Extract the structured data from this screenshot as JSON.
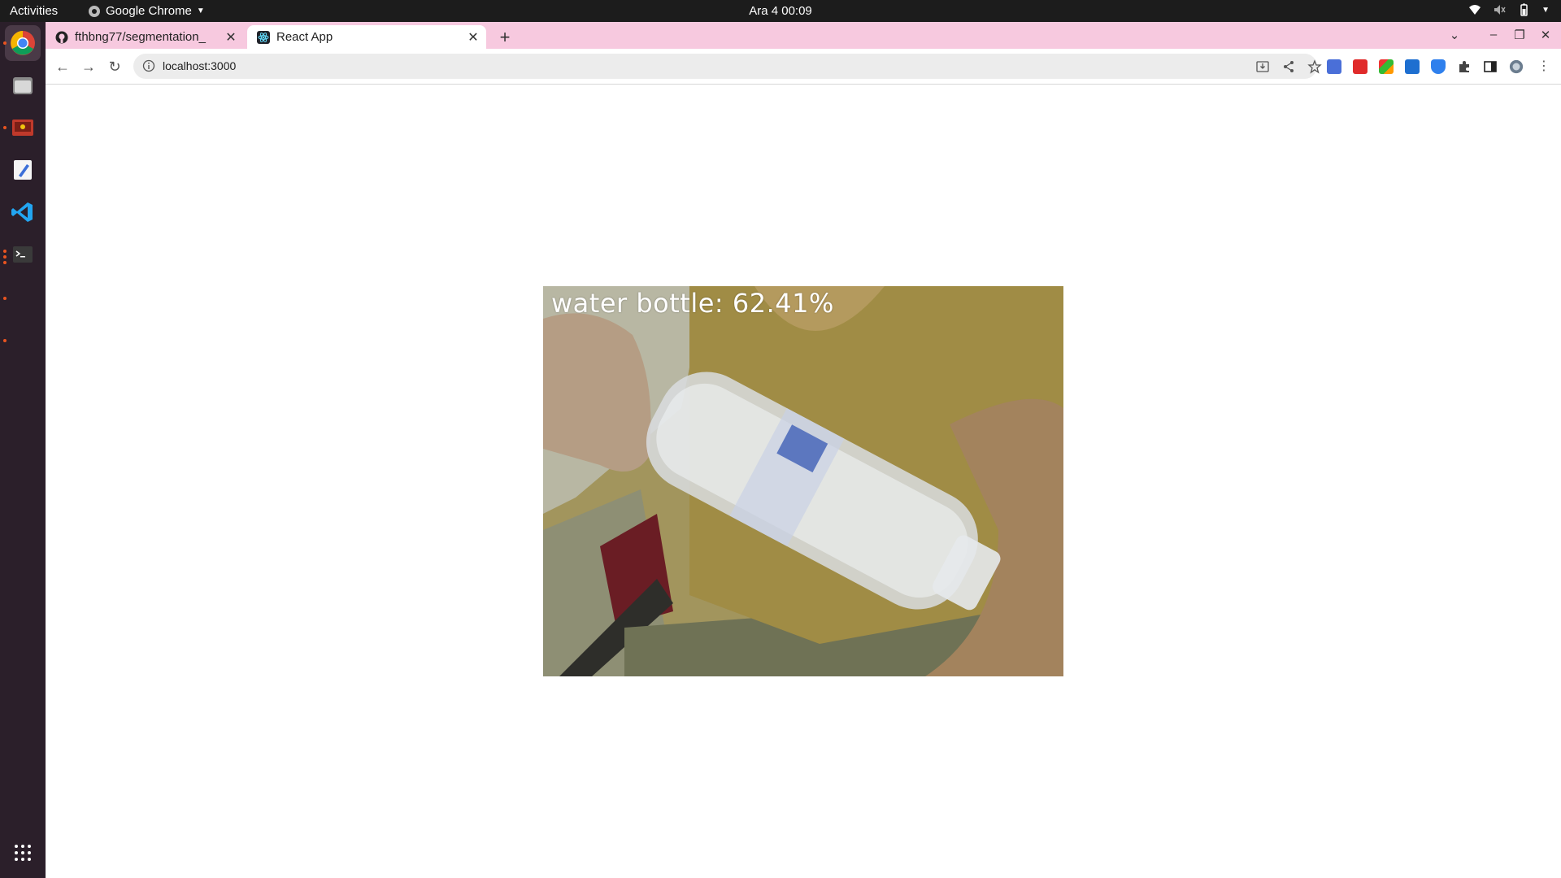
{
  "topbar": {
    "activities": "Activities",
    "app_name": "Google Chrome",
    "clock": "Ara 4  00:09"
  },
  "dock": {
    "items": [
      "chrome-icon",
      "files-icon",
      "screen-recorder-icon",
      "text-editor-icon",
      "vscode-icon",
      "terminal-icon"
    ],
    "show_apps": "apps-grid-icon"
  },
  "browser": {
    "tabs": [
      {
        "title": "fthbng77/segmentation_",
        "favicon": "github-icon",
        "active": false
      },
      {
        "title": "React App",
        "favicon": "react-icon",
        "active": true
      }
    ],
    "url": "localhost:3000",
    "accent": "#f7c9df"
  },
  "page": {
    "prediction_label": "water bottle: 62.41%"
  }
}
